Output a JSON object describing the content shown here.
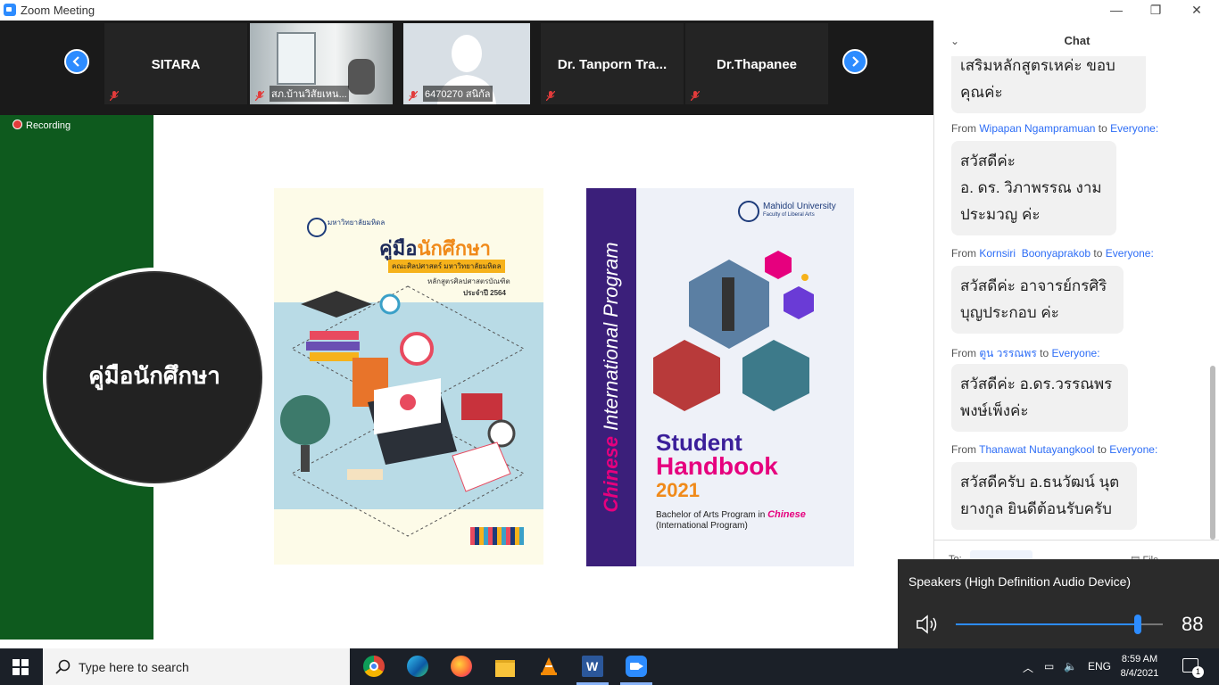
{
  "window": {
    "title": "Zoom Meeting",
    "minimize": "—",
    "restore": "❐",
    "close": "✕"
  },
  "participants": [
    {
      "name": "SITARA",
      "label": ""
    },
    {
      "name": "",
      "label": "สภ.บ้านวิสัยเหน..."
    },
    {
      "name": "",
      "label": "6470270 สนิกัล"
    },
    {
      "name": "Dr. Tanporn Tra...",
      "label": ""
    },
    {
      "name": "Dr.Thapanee",
      "label": ""
    }
  ],
  "recording": {
    "label": "Recording"
  },
  "slide": {
    "heading": "คู่มือนักศึกษา",
    "book1": {
      "university": "มหาวิทยาลัยมหิดล",
      "title_prefix": "คู่มือ",
      "title_highlight": "นักศึกษา",
      "faculty": "คณะศิลปศาสตร์ มหาวิทยาลัยมหิดล",
      "program": "หลักสูตรศิลปศาสตรบัณฑิต",
      "year": "ประจำปี 2564"
    },
    "book2": {
      "side_highlight": "Chinese",
      "side_text": " International Program",
      "univ": "Mahidol University",
      "faculty": "Faculty of Liberal Arts",
      "title1": "Student",
      "title2": "Handbook",
      "year": "2021",
      "program_prefix": "Bachelor of Arts Program in ",
      "program_highlight": "Chinese",
      "program_suffix": "(International Program)"
    }
  },
  "chat": {
    "title": "Chat",
    "partial_top_line1": "เสริมหลักสูตรเหค่ะ ขอบ",
    "partial_top_line2": "คุณค่ะ",
    "messages": [
      {
        "from_label": "From",
        "sender": "Wipapan Ngampramuan",
        "to_label": "to",
        "to": "Everyone:",
        "lines": [
          "สวัสดีค่ะ",
          "อ. ดร. วิภาพรรณ งาม",
          "ประมวญ ค่ะ"
        ]
      },
      {
        "from_label": "From",
        "sender": "Kornsiri  Boonyaprakob",
        "to_label": "to",
        "to": "Everyone:",
        "lines": [
          "สวัสดีค่ะ อาจารย์กรศิริ",
          "บุญประกอบ ค่ะ"
        ]
      },
      {
        "from_label": "From",
        "sender": "ตูน วรรณพร",
        "to_label": "to",
        "to": "Everyone:",
        "lines": [
          "สวัสดีค่ะ อ.ดร.วรรณพร",
          "พงษ์เพ็งค่ะ"
        ]
      },
      {
        "from_label": "From",
        "sender": "Thanawat Nutayangkool",
        "to_label": "to",
        "to": "Everyone:",
        "lines": [
          "สวัสดีครับ อ.ธนวัฒน์ นุต",
          "ยางกูล ยินดีต้อนรับครับ"
        ]
      }
    ],
    "footer_to": "To:",
    "footer_file": "File"
  },
  "volume": {
    "device": "Speakers (High Definition Audio Device)",
    "level": 88,
    "level_label": "88"
  },
  "taskbar": {
    "search_placeholder": "Type here to search",
    "lang": "ENG",
    "time": "8:59 AM",
    "date": "8/4/2021",
    "notification_count": "1"
  },
  "colors": {
    "zoom_blue": "#2D8CFF",
    "green_panel": "#0e5a1e",
    "purple_spine": "#3b1f7a",
    "magenta": "#e6007e"
  }
}
